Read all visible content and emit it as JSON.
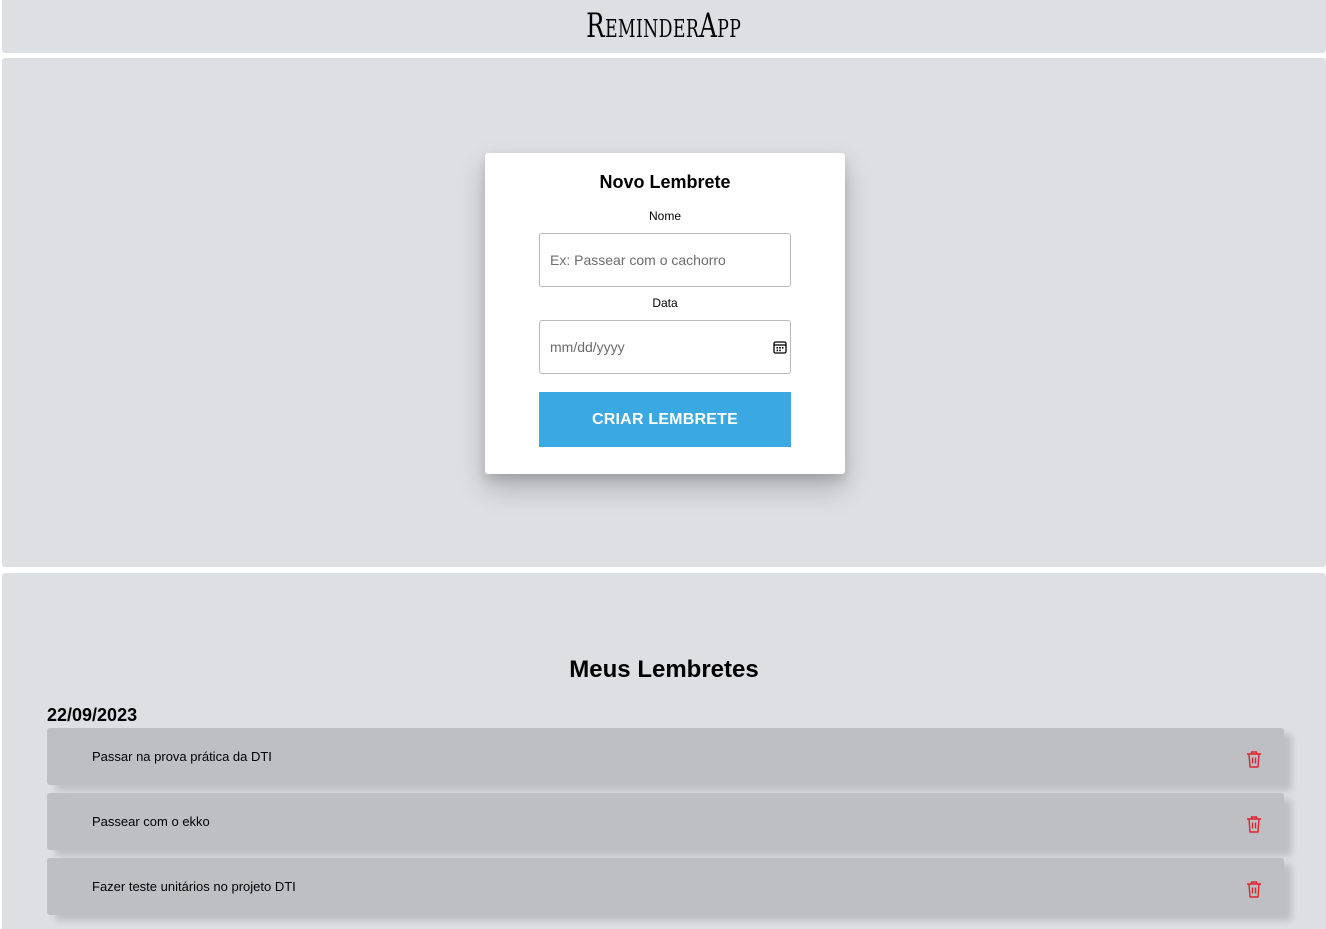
{
  "header": {
    "app_name": "ReminderApp"
  },
  "form": {
    "title": "Novo Lembrete",
    "name_label": "Nome",
    "name_placeholder": "Ex: Passear com o cachorro",
    "date_label": "Data",
    "date_placeholder": "mm/dd/yyyy",
    "submit_label": "CRIAR LEMBRETE",
    "button_color": "#3aa8e2"
  },
  "reminders": {
    "title": "Meus Lembretes",
    "groups": [
      {
        "date": "22/09/2023",
        "items": [
          {
            "text": "Passar na prova prática da DTI",
            "icon": "trash-icon"
          },
          {
            "text": "Passear com o ekko",
            "icon": "trash-icon"
          },
          {
            "text": "Fazer teste unitários no projeto DTI",
            "icon": "trash-icon"
          }
        ]
      }
    ],
    "delete_icon_color": "#e0202a"
  }
}
